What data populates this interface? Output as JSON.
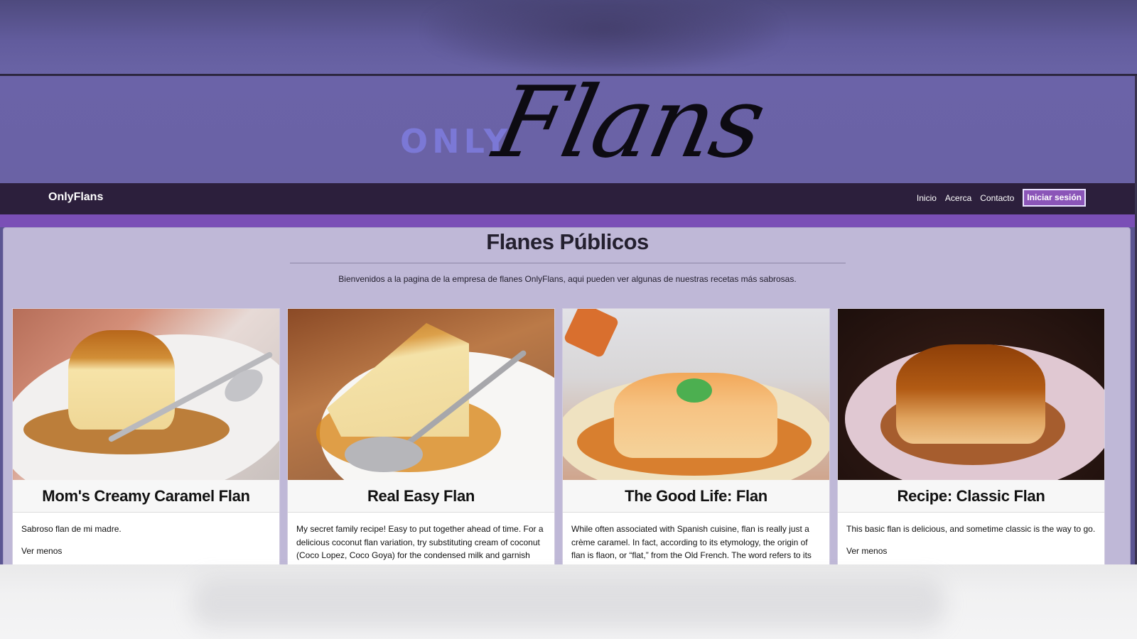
{
  "logo": {
    "only": "ONLY",
    "flans": "Flans"
  },
  "nav": {
    "brand": "OnlyFlans",
    "links": [
      "Inicio",
      "Acerca",
      "Contacto"
    ],
    "login": "Iniciar sesión"
  },
  "main": {
    "title": "Flanes Públicos",
    "intro": "Bienvenidos a la pagina de la empresa de flanes OnlyFlans, aqui pueden ver algunas de nuestras recetas más sabrosas."
  },
  "cards": [
    {
      "title": "Mom's Creamy Caramel Flan",
      "description": "Sabroso flan de mi madre.",
      "toggle": "Ver menos"
    },
    {
      "title": "Real Easy Flan",
      "description": "My secret family recipe! Easy to put together ahead of time. For a delicious coconut flan variation, try substituting cream of coconut (Coco Lopez, Coco Goya) for the condensed milk and garnish with shredded coconut if desired.",
      "toggle": ""
    },
    {
      "title": "The Good Life: Flan",
      "description": "While often associated with Spanish cuisine, flan is really just a crème caramel. In fact, according to its etymology, the origin of flan is flaon, or “flat,” from the Old French. The word refers to its flat or broad appearance, particularly when baked in a small dish.",
      "toggle": ""
    },
    {
      "title": "Recipe: Classic Flan",
      "description": "This basic flan is delicious, and sometime classic is the way to go.",
      "toggle": "Ver menos"
    }
  ],
  "colors": {
    "navbar": "#2c1f3c",
    "accent": "#7a4fb6",
    "banner": "#6a62a5",
    "content_bg": "#bfb8d7"
  }
}
